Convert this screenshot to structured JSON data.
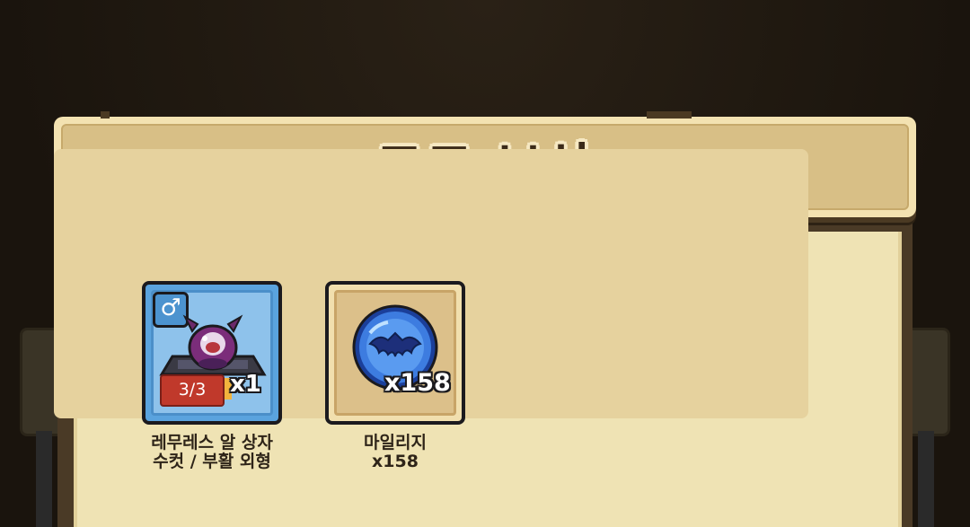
{
  "dialog": {
    "title": "코드 보상"
  },
  "rewards": [
    {
      "icon": "egg-box-icon",
      "gender_icon": "♂",
      "stage_badge": "3/3",
      "count": "x1",
      "label_line1": "레무레스 알 상자",
      "label_line2": "수컷 / 부활 외형",
      "frame_color": "#5aa3de"
    },
    {
      "icon": "mileage-coin-icon",
      "count": "x158",
      "label_line1": "마일리지",
      "label_line2": "x158",
      "frame_color": "#f1dfae"
    }
  ],
  "colors": {
    "header": "#d8bf86",
    "panel": "#efe3b4",
    "title_text": "#3b2a18",
    "stage_badge": "#c0392b"
  }
}
